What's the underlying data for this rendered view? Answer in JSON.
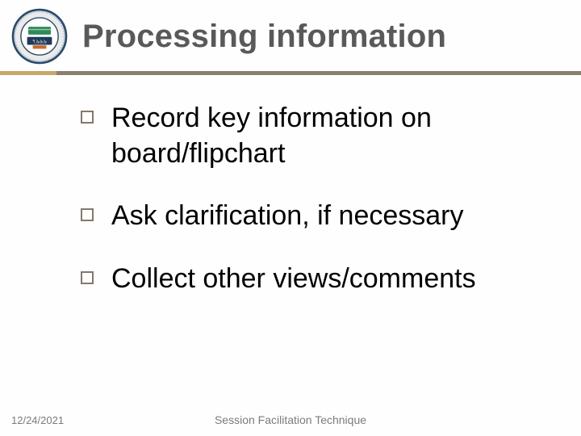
{
  "title": "Processing information",
  "bullets": [
    "Record key information on board/flipchart",
    "Ask clarification, if necessary",
    "Collect other views/comments"
  ],
  "footer": {
    "date": "12/24/2021",
    "center": "Session Facilitation Technique"
  },
  "colors": {
    "title": "#595959",
    "rule_accent": "#c5a96a",
    "rule_main": "#8b8070",
    "bullet_border": "#85796a"
  }
}
